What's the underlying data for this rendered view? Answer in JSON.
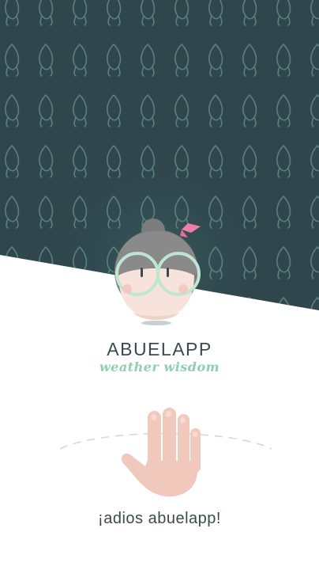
{
  "app": {
    "name": "ABUELAPP",
    "tagline": "weather wisdom"
  },
  "farewell_label": "¡adios abuelapp!",
  "colors": {
    "header_bg": "#2f464c",
    "pattern": "#5f8b83",
    "accent_green": "#8ecfae",
    "text_dark": "#3b4a50",
    "bow_pink": "#ef7fa6",
    "hand": "#f1c9bc"
  },
  "icons": {
    "mascot": "grandma-face-icon",
    "hand": "waving-hand-icon",
    "pattern": "drop-knot-pattern"
  }
}
